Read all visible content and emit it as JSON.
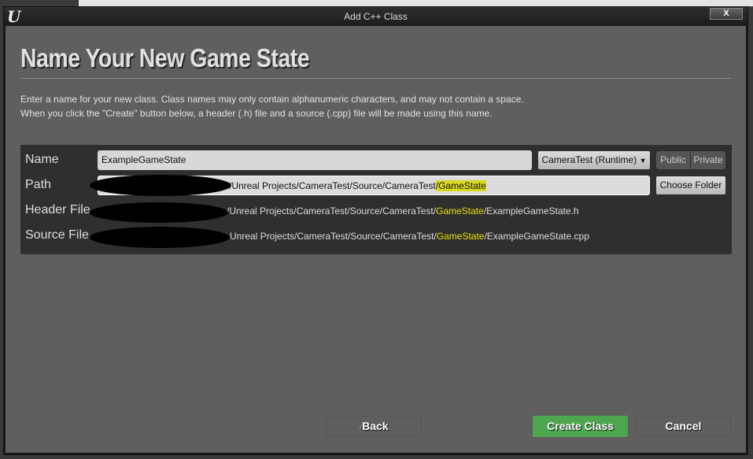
{
  "window": {
    "title": "Add C++ Class",
    "logo": "U",
    "close_label": "X"
  },
  "heading": "Name Your New Game State",
  "description": [
    "Enter a name for your new class. Class names may only contain alphanumeric characters, and may not contain a space.",
    "When you click the \"Create\" button below, a header (.h) file and a source (.cpp) file will be made using this name."
  ],
  "form": {
    "name_label": "Name",
    "name_value": "ExampleGameState",
    "module_select": "CameraTest (Runtime)",
    "public_label": "Public",
    "private_label": "Private",
    "path_label": "Path",
    "path_prefix": "/Unreal Projects/CameraTest/Source/CameraTest",
    "path_highlight": "/GameState",
    "choose_folder_label": "Choose Folder",
    "header_label": "Header File",
    "header_prefix": "/Unreal Projects/CameraTest/Source/CameraTest/",
    "header_highlight": "GameState",
    "header_suffix": "/ExampleGameState.h",
    "source_label": "Source File",
    "source_prefix": "Unreal Projects/CameraTest/Source/CameraTest/",
    "source_highlight": "GameState",
    "source_suffix": "/ExampleGameState.cpp"
  },
  "footer": {
    "back_label": "Back",
    "create_label": "Create Class",
    "cancel_label": "Cancel"
  },
  "colors": {
    "accent_green": "#4ea74f",
    "highlight": "#e5e000"
  }
}
